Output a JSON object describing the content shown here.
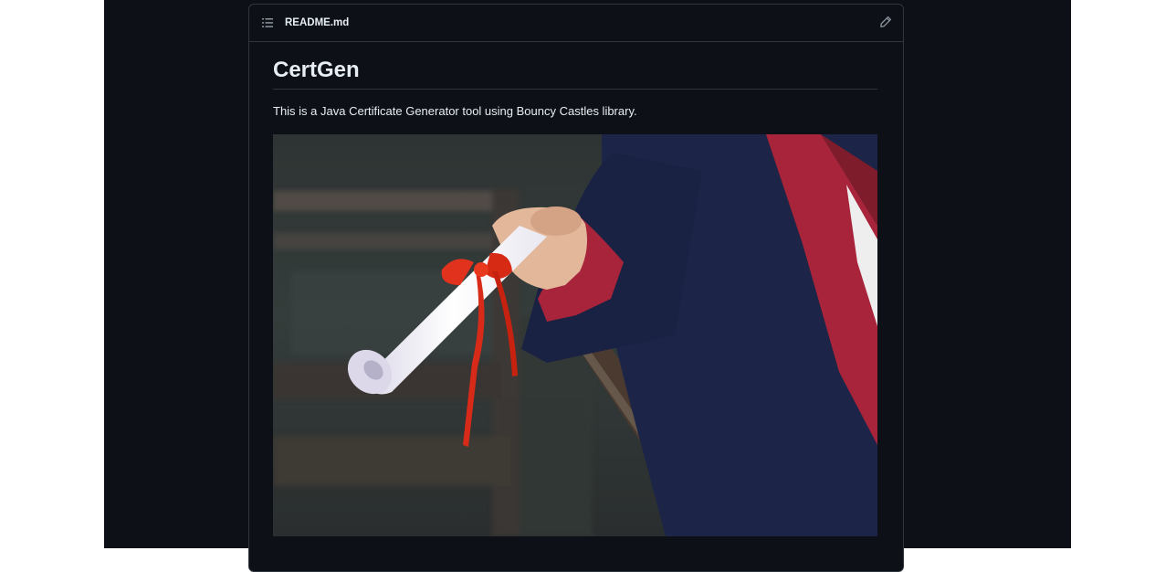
{
  "readme": {
    "filename": "README.md",
    "title": "CertGen",
    "description": "This is a Java Certificate Generator tool using Bouncy Castles library.",
    "image_alt": "Graduate holding rolled diploma tied with red ribbon"
  },
  "icons": {
    "toc": "list-unordered-icon",
    "edit": "pencil-icon"
  },
  "colors": {
    "page_bg": "#0d1117",
    "border": "#30363d",
    "text": "#e6edf3",
    "ribbon": "#e0321c",
    "gown_navy": "#1c2547",
    "gown_red": "#a8243a"
  }
}
